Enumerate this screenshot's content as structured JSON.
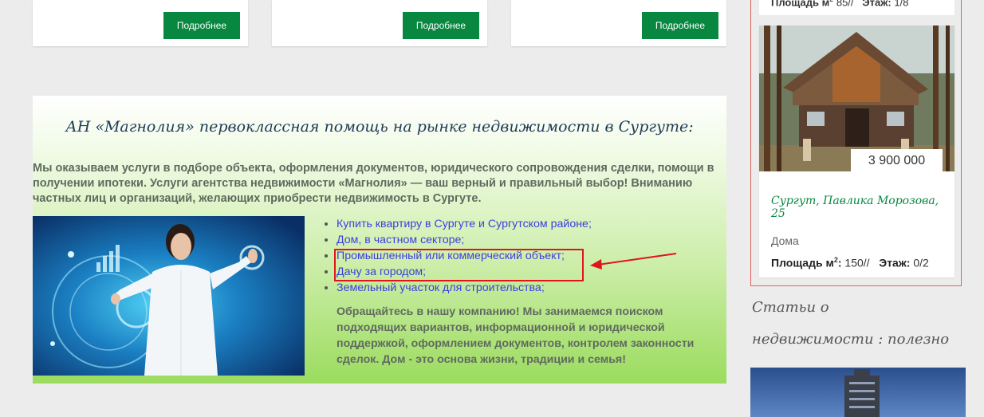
{
  "cards": [
    {
      "button": "Подробнее"
    },
    {
      "button": "Подробнее"
    },
    {
      "button": "Подробнее"
    }
  ],
  "info": {
    "title": "АН «Магнолия» первоклассная помощь на рынке недвижимости в Сургуте:",
    "lead": "Мы оказываем услуги в подборе объекта, оформления документов, юридического сопровождения сделки, помощи в получении ипотеки. Услуги агентства недвижимости «Магнолия» — ваш верный и правильный выбор! Вниманию частных лиц и организаций, желающих приобрести недвижимость в Сургуте.",
    "services": [
      "Купить квартиру в Сургуте и Сургутском районе;",
      "Дом, в частном секторе;",
      "Промышленный или коммерческий объект;",
      "Дачу за городом;",
      "Земельный участок для строительства;"
    ],
    "closing": "Обращайтесь в нашу компанию! Мы занимаемся поиском подходящих вариантов, информационной и юридической поддержкой, оформлением документов, контролем законности сделок. Дом - это основа жизни, традиции и семья!"
  },
  "sidebar": {
    "top_card": {
      "area_label": "Площадь м",
      "area_sup": "2",
      "area_value": "85//",
      "floor_label": "Этаж:",
      "floor_value": "1/8"
    },
    "listing": {
      "price": "3 900 000",
      "address": "Сургут, Павлика Морозова, 25",
      "type": "Дома",
      "area_label": "Площадь м",
      "area_sup": "2",
      "area_colon": ":",
      "area_value": "150//",
      "floor_label": "Этаж:",
      "floor_value": "0/2"
    },
    "articles_title": "Статьи о недвижимости : полезно знать"
  },
  "colors": {
    "button_green": "#07873f",
    "link_blue": "#3b3fdd",
    "annotation_red": "#e2141b"
  }
}
